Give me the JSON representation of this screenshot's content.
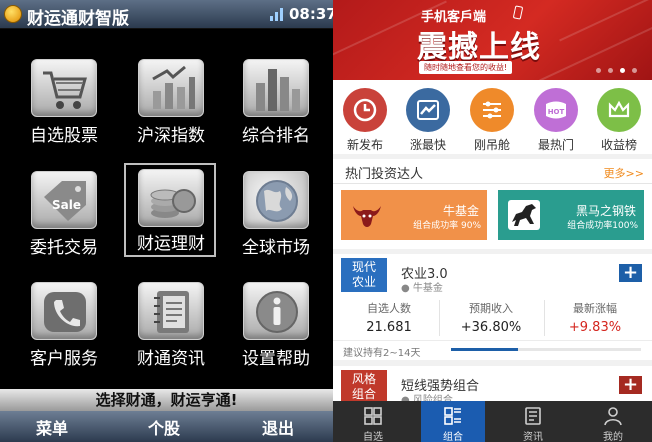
{
  "left_app": {
    "title": "财运通财智版",
    "time": "08:37",
    "tiles": [
      {
        "label": "自选股票",
        "icon": "shopping-cart-icon"
      },
      {
        "label": "沪深指数",
        "icon": "bar-chart-icon"
      },
      {
        "label": "综合排名",
        "icon": "ranking-bars-icon"
      },
      {
        "label": "委托交易",
        "icon": "sale-tag-icon"
      },
      {
        "label": "财运理财",
        "icon": "coins-icon"
      },
      {
        "label": "全球市场",
        "icon": "globe-icon"
      },
      {
        "label": "客户服务",
        "icon": "phone-icon"
      },
      {
        "label": "财通资讯",
        "icon": "notebook-icon"
      },
      {
        "label": "设置帮助",
        "icon": "info-icon"
      }
    ],
    "selected_tile": "财运理财",
    "slogan": "选择财通，财运亨通!",
    "softkeys": {
      "left": "菜单",
      "center": "个股",
      "right": "退出"
    }
  },
  "right_app": {
    "banner": {
      "subtitle": "手机客戶端",
      "headline": "震撼上线",
      "tagline": "随时随地查看您的收益!",
      "slides": 4,
      "active_slide": 3
    },
    "categories": [
      {
        "label": "新发布",
        "icon": "clock-icon",
        "color": "#c9423a"
      },
      {
        "label": "涨最快",
        "icon": "trend-chart-icon",
        "color": "#3b6aa0"
      },
      {
        "label": "刚吊舱",
        "icon": "sliders-icon",
        "color": "#ef8a2a"
      },
      {
        "label": "最热门",
        "icon": "hot-badge-icon",
        "color": "#bf6fd6",
        "badge": "HOT"
      },
      {
        "label": "收益榜",
        "icon": "crown-icon",
        "color": "#7dbf47"
      }
    ],
    "hot": {
      "title": "热门投资达人",
      "more": "更多>>",
      "cards": [
        {
          "name": "牛基金",
          "rate": "组合成功率 90%",
          "color": "#f19149",
          "icon": "bull-icon"
        },
        {
          "name": "黑马之钢铁",
          "rate": "组合成功率100%",
          "color": "#2a9d8f",
          "icon": "horse-icon"
        }
      ]
    },
    "groups": [
      {
        "badge": [
          "现代",
          "农业"
        ],
        "badge_color": "#2a6fbf",
        "name": "农业3.0",
        "manager": "牛基金",
        "plus": "+",
        "stats": [
          {
            "label": "自选人数",
            "value": "21.681"
          },
          {
            "label": "预期收入",
            "value": "+36.80%"
          },
          {
            "label": "最新涨幅",
            "value": "+9.83%"
          }
        ],
        "advice": "建议持有2~14天",
        "progress": 0.35
      },
      {
        "badge": [
          "风格",
          "组合"
        ],
        "badge_color": "#c0392b",
        "name": "短线强势组合",
        "manager": "风险组合",
        "plus": "+"
      }
    ],
    "tabs": [
      {
        "label": "自选",
        "icon": "watchlist-icon"
      },
      {
        "label": "组合",
        "icon": "portfolio-icon"
      },
      {
        "label": "资讯",
        "icon": "news-icon"
      },
      {
        "label": "我的",
        "icon": "user-icon"
      }
    ],
    "active_tab": "组合"
  }
}
